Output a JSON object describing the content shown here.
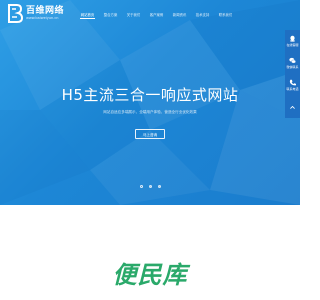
{
  "brand": {
    "name": "百维网络",
    "domain": "www.baiweiyun.cn",
    "icon": "logo-b-icon"
  },
  "nav": {
    "items": [
      {
        "label": "网站首页",
        "active": true
      },
      {
        "label": "整合方案",
        "active": false
      },
      {
        "label": "关于我们",
        "active": false
      },
      {
        "label": "客户案例",
        "active": false
      },
      {
        "label": "新闻资讯",
        "active": false
      },
      {
        "label": "技术支持",
        "active": false
      },
      {
        "label": "联系我们",
        "active": false
      }
    ]
  },
  "hero": {
    "title": "H5主流三合一响应式网站",
    "subtitle": "网站自适应多端展示，全端用户体验，营造全行业优化效果",
    "button_label": "马上咨询",
    "slides": {
      "count": 3,
      "active_index": 0
    }
  },
  "side_panel": {
    "items": [
      {
        "label": "在线客服",
        "icon": "qq-icon"
      },
      {
        "label": "微信联系",
        "icon": "wechat-icon"
      },
      {
        "label": "联系电话",
        "icon": "phone-icon"
      },
      {
        "label": "",
        "icon": "arrow-up-icon"
      }
    ]
  },
  "watermark": {
    "text": "便民库"
  },
  "colors": {
    "hero_blue": "#1d87d6",
    "accent_green": "#2aa96a",
    "side_panel": "#1f6fc2"
  }
}
